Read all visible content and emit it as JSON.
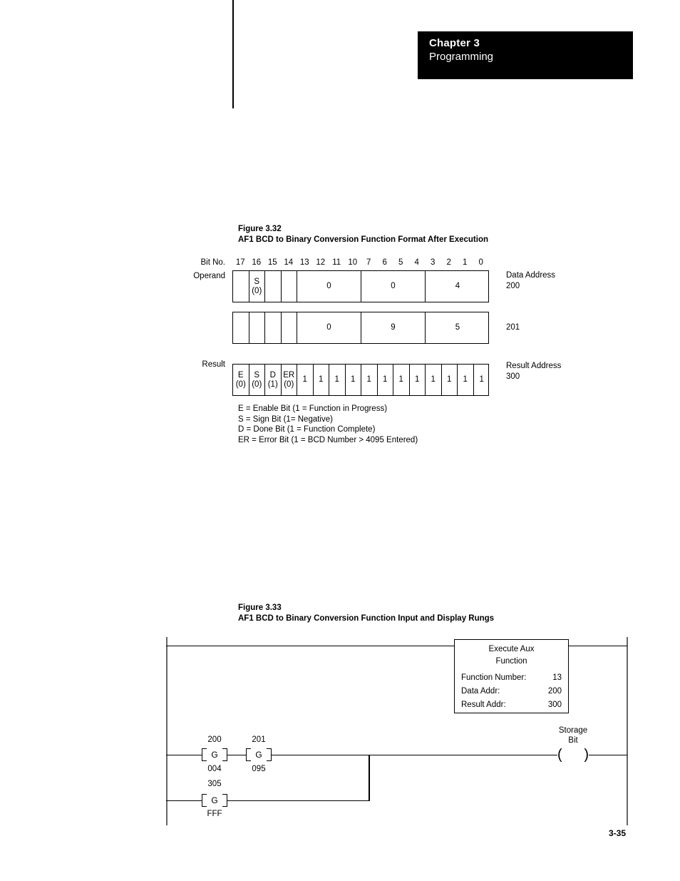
{
  "page": {
    "chapter_label": "Chapter 3",
    "chapter_name": "Programming",
    "page_number": "3-35"
  },
  "figure_3_32": {
    "caption_line1": "Figure 3.32",
    "caption_line2": "AF1 BCD to Binary Conversion Function Format After Execution",
    "bit_no_label": "Bit No.",
    "operand_label": "Operand",
    "result_label": "Result",
    "bit_numbers": [
      "17",
      "16",
      "15",
      "14",
      "13",
      "12",
      "11",
      "10",
      "7",
      "6",
      "5",
      "4",
      "3",
      "2",
      "1",
      "0"
    ],
    "operand_row_1": [
      {
        "main": "",
        "sub": "",
        "span": 1
      },
      {
        "main": "S",
        "sub": "(0)",
        "span": 1
      },
      {
        "main": "",
        "sub": "",
        "span": 1
      },
      {
        "main": "",
        "sub": "",
        "span": 1
      },
      {
        "main": "0",
        "sub": "",
        "span": 4
      },
      {
        "main": "0",
        "sub": "",
        "span": 4
      },
      {
        "main": "4",
        "sub": "",
        "span": 4
      }
    ],
    "operand_row_2": [
      {
        "main": "",
        "sub": "",
        "span": 1
      },
      {
        "main": "",
        "sub": "",
        "span": 1
      },
      {
        "main": "",
        "sub": "",
        "span": 1
      },
      {
        "main": "",
        "sub": "",
        "span": 1
      },
      {
        "main": "0",
        "sub": "",
        "span": 4
      },
      {
        "main": "9",
        "sub": "",
        "span": 4
      },
      {
        "main": "5",
        "sub": "",
        "span": 4
      }
    ],
    "result_row": [
      {
        "main": "E",
        "sub": "(0)",
        "span": 1
      },
      {
        "main": "S",
        "sub": "(0)",
        "span": 1
      },
      {
        "main": "D",
        "sub": "(1)",
        "span": 1
      },
      {
        "main": "ER",
        "sub": "(0)",
        "span": 1
      },
      {
        "main": "1",
        "sub": "",
        "span": 1
      },
      {
        "main": "1",
        "sub": "",
        "span": 1
      },
      {
        "main": "1",
        "sub": "",
        "span": 1
      },
      {
        "main": "1",
        "sub": "",
        "span": 1
      },
      {
        "main": "1",
        "sub": "",
        "span": 1
      },
      {
        "main": "1",
        "sub": "",
        "span": 1
      },
      {
        "main": "1",
        "sub": "",
        "span": 1
      },
      {
        "main": "1",
        "sub": "",
        "span": 1
      },
      {
        "main": "1",
        "sub": "",
        "span": 1
      },
      {
        "main": "1",
        "sub": "",
        "span": 1
      },
      {
        "main": "1",
        "sub": "",
        "span": 1
      },
      {
        "main": "1",
        "sub": "",
        "span": 1
      }
    ],
    "data_address_label": "Data Address",
    "data_address_value": "200",
    "operand_2_address": "201",
    "result_address_label": "Result Address",
    "result_address_value": "300",
    "legend": [
      "E = Enable Bit (1 = Function in Progress)",
      "S = Sign Bit (1= Negative)",
      "D = Done Bit (1 = Function Complete)",
      "ER = Error Bit (1 = BCD Number > 4095 Entered)"
    ]
  },
  "figure_3_33": {
    "caption_line1": "Figure 3.33",
    "caption_line2": "AF1 BCD to Binary Conversion Function Input and Display Rungs",
    "aux_block": {
      "title_line1": "Execute Aux",
      "title_line2": "Function",
      "rows": [
        {
          "label": "Function Number:",
          "value": "13"
        },
        {
          "label": "Data Addr:",
          "value": "200"
        },
        {
          "label": "Result Addr:",
          "value": "300"
        }
      ]
    },
    "contacts": [
      {
        "top_tag": "200",
        "symbol": "G",
        "bottom_tag": "004"
      },
      {
        "top_tag": "201",
        "symbol": "G",
        "bottom_tag": "095"
      },
      {
        "top_tag": "305",
        "symbol": "G",
        "bottom_tag": "FFF"
      }
    ],
    "coil": {
      "label_line1": "Storage",
      "label_line2": "Bit"
    }
  }
}
